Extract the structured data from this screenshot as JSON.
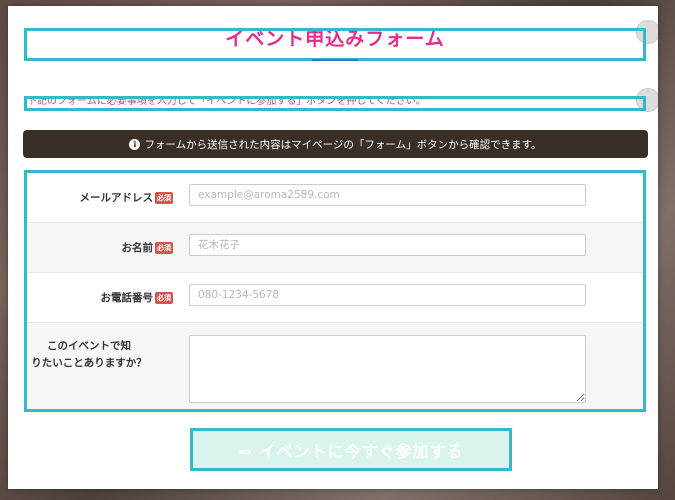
{
  "modal": {
    "title": "イベント申込みフォーム",
    "intro": "下記のフォームに必要事項を入力して「イベントに参加する」ボタンを押してください。",
    "notice": "フォームから送信された内容はマイページの「フォーム」ボタンから確認できます。",
    "notice_icon": "info-icon"
  },
  "form": {
    "required_label": "必須",
    "fields": [
      {
        "label": "メールアドレス",
        "placeholder": "example@aroma2589.com",
        "required": true
      },
      {
        "label": "お名前",
        "placeholder": "花木花子",
        "required": true
      },
      {
        "label": "お電話番号",
        "placeholder": "080-1234-5678",
        "required": true
      },
      {
        "label": "このイベントで知りたいことありますか？",
        "placeholder": "",
        "required": false
      }
    ]
  },
  "submit": {
    "label": "⇒ イベントに今すぐ参加する"
  },
  "colors": {
    "accent": "#35b9c9",
    "title": "#e62b8f",
    "notice_bg": "#3a2f26",
    "required_bg": "#d9534f",
    "submit_bg": "#d9f3ef"
  }
}
